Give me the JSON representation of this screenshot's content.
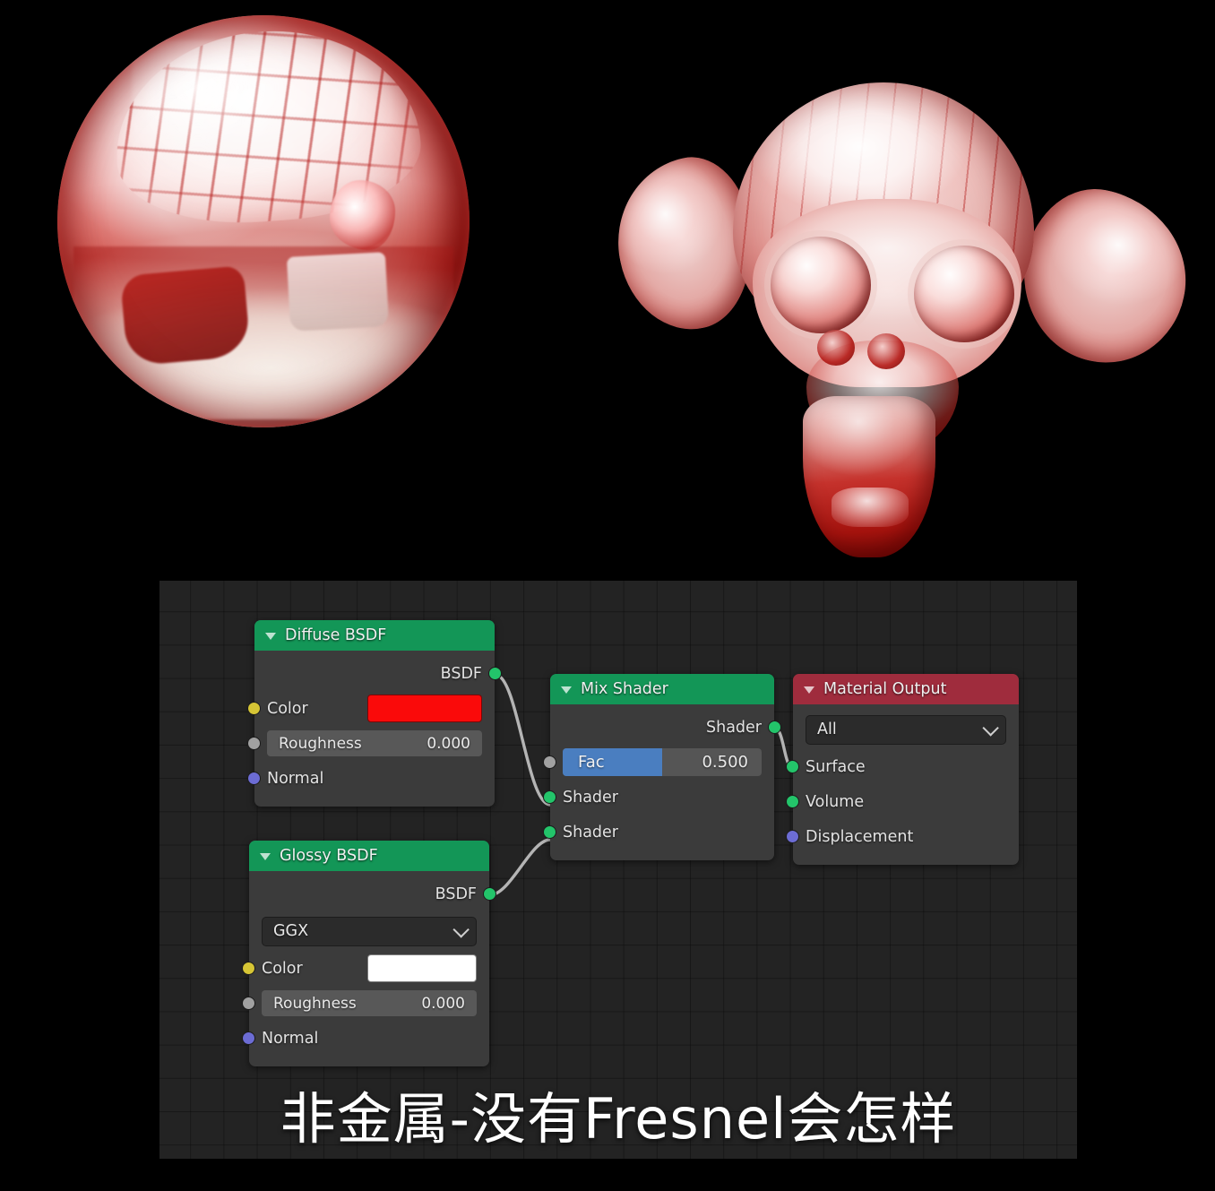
{
  "render": {
    "background_color": "#000000",
    "objects": [
      {
        "name": "glossy-red-sphere",
        "material": "non-metal red glossy, no fresnel"
      },
      {
        "name": "suzanne-monkey-head",
        "material": "non-metal red glossy, no fresnel"
      }
    ]
  },
  "node_editor": {
    "background_color": "#232323",
    "caption": "非金属-没有Fresnel会怎样",
    "nodes": [
      {
        "id": "diffuse",
        "title": "Diffuse BSDF",
        "header_color": "#139657",
        "outputs": [
          {
            "label": "BSDF",
            "socket": "green"
          }
        ],
        "inputs": [
          {
            "label": "Color",
            "socket": "yellow",
            "widget": "color",
            "value": "#fa0a0a"
          },
          {
            "label": "Roughness",
            "socket": "gray",
            "widget": "value",
            "value": "0.000"
          },
          {
            "label": "Normal",
            "socket": "blue",
            "widget": "none"
          }
        ]
      },
      {
        "id": "glossy",
        "title": "Glossy BSDF",
        "header_color": "#139657",
        "outputs": [
          {
            "label": "BSDF",
            "socket": "green"
          }
        ],
        "distribution": "GGX",
        "inputs": [
          {
            "label": "Color",
            "socket": "yellow",
            "widget": "color",
            "value": "#ffffff"
          },
          {
            "label": "Roughness",
            "socket": "gray",
            "widget": "value",
            "value": "0.000"
          },
          {
            "label": "Normal",
            "socket": "blue",
            "widget": "none"
          }
        ]
      },
      {
        "id": "mix",
        "title": "Mix Shader",
        "header_color": "#139657",
        "outputs": [
          {
            "label": "Shader",
            "socket": "green"
          }
        ],
        "inputs": [
          {
            "label": "Fac",
            "socket": "gray",
            "widget": "slider",
            "value": "0.500",
            "fill_color": "#4a7ec0"
          },
          {
            "label": "Shader",
            "socket": "green",
            "widget": "none"
          },
          {
            "label": "Shader",
            "socket": "green",
            "widget": "none"
          }
        ]
      },
      {
        "id": "output",
        "title": "Material Output",
        "header_color": "#9f2c3d",
        "target": "All",
        "inputs": [
          {
            "label": "Surface",
            "socket": "green",
            "widget": "none"
          },
          {
            "label": "Volume",
            "socket": "green",
            "widget": "none"
          },
          {
            "label": "Displacement",
            "socket": "blue",
            "widget": "none"
          }
        ]
      }
    ],
    "links": [
      {
        "from": "diffuse.BSDF",
        "to": "mix.Shader1"
      },
      {
        "from": "glossy.BSDF",
        "to": "mix.Shader2"
      },
      {
        "from": "mix.Shader",
        "to": "output.Surface"
      }
    ]
  }
}
